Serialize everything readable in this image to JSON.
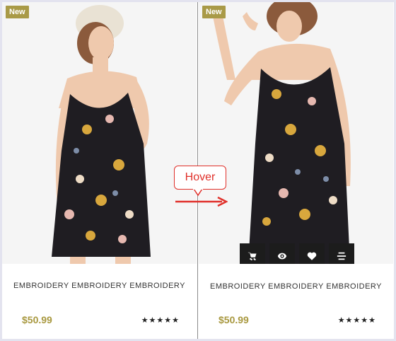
{
  "products": [
    {
      "badge": "New",
      "title": "EMBROIDERY EMBROIDERY EMBROIDERY",
      "price": "$50.99",
      "rating_stars": 5,
      "stars_text": "★★★★★"
    },
    {
      "badge": "New",
      "title": "EMBROIDERY EMBROIDERY EMBROIDERY",
      "price": "$50.99",
      "rating_stars": 5,
      "stars_text": "★★★★★",
      "hover_actions": [
        "cart-icon",
        "eye-icon",
        "heart-icon",
        "compare-icon"
      ]
    }
  ],
  "annotation": {
    "label": "Hover",
    "color": "#e0302a"
  },
  "colors": {
    "accent_gold": "#a99a47",
    "action_bg": "#1c1c1c"
  }
}
